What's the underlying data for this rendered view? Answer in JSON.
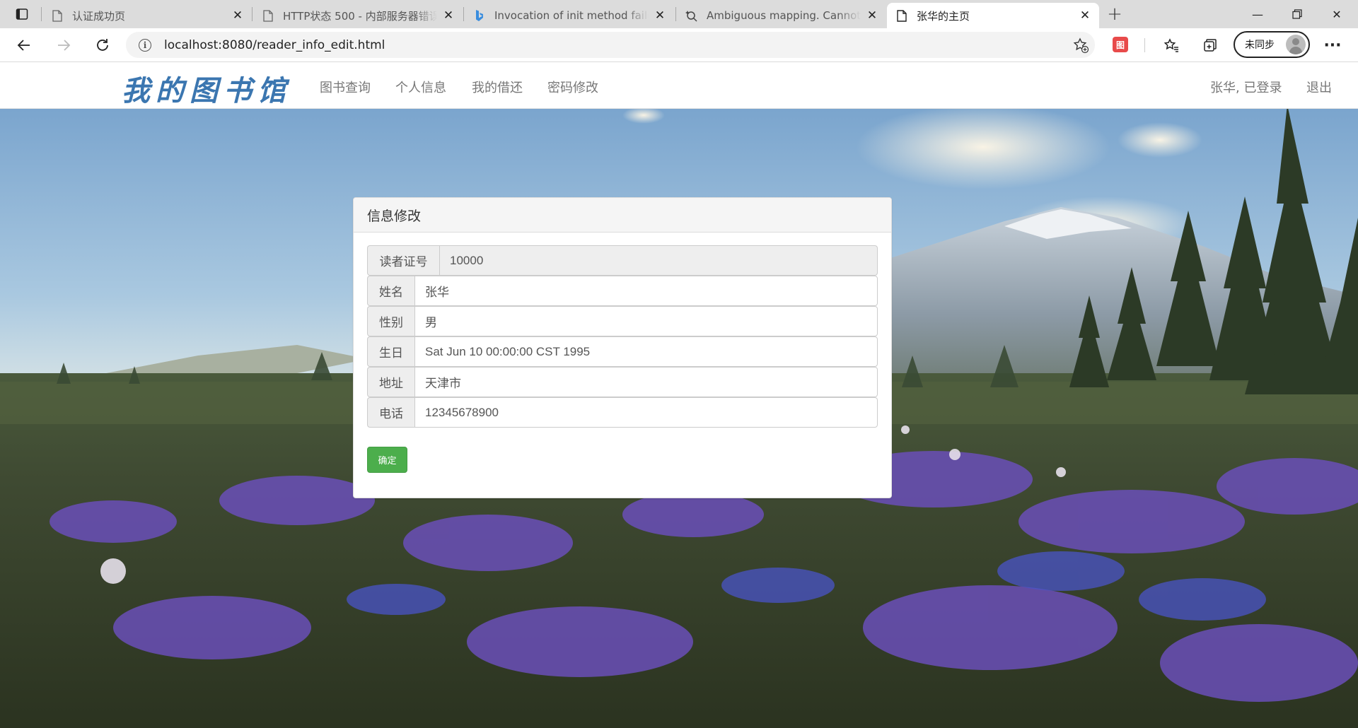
{
  "browser": {
    "tabs": [
      {
        "title": "认证成功页",
        "active": false
      },
      {
        "title": "HTTP状态 500 - 内部服务器错误",
        "active": false
      },
      {
        "title": "Invocation of init method failed; nested exception",
        "active": false
      },
      {
        "title": "Ambiguous mapping. Cannot map",
        "active": false
      },
      {
        "title": "张华的主页",
        "active": true
      }
    ],
    "url": "localhost:8080/reader_info_edit.html",
    "profile_label": "未同步",
    "extension_label": "图"
  },
  "nav": {
    "brand": "我的图书馆",
    "links": [
      "图书查询",
      "个人信息",
      "我的借还",
      "密码修改"
    ],
    "user_status": "张华, 已登录",
    "logout": "退出"
  },
  "form": {
    "heading": "信息修改",
    "fields": [
      {
        "label": "读者证号",
        "value": "10000",
        "readonly": true
      },
      {
        "label": "姓名",
        "value": "张华",
        "readonly": false
      },
      {
        "label": "性别",
        "value": "男",
        "readonly": false
      },
      {
        "label": "生日",
        "value": "Sat Jun 10 00:00:00 CST 1995",
        "readonly": false
      },
      {
        "label": "地址",
        "value": "天津市",
        "readonly": false
      },
      {
        "label": "电话",
        "value": "12345678900",
        "readonly": false
      }
    ],
    "submit_label": "确定"
  },
  "colors": {
    "brand": "#3b76b0",
    "submit": "#4cae4c"
  }
}
